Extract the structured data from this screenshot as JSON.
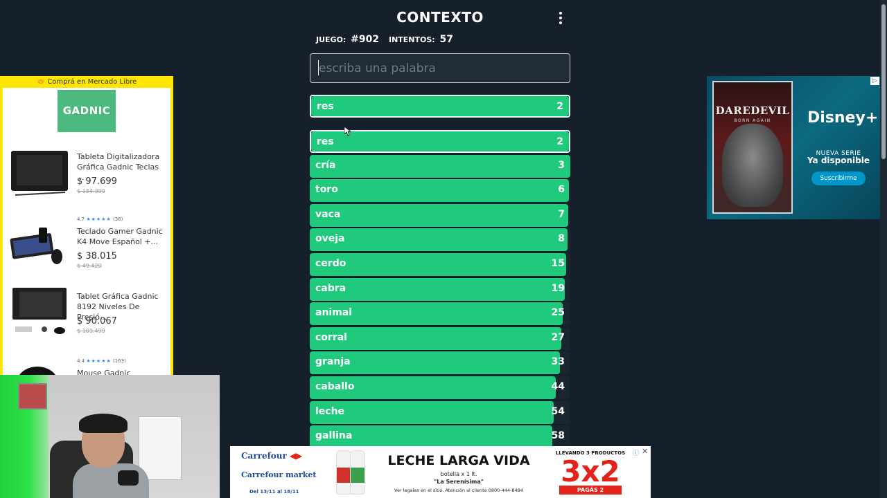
{
  "header": {
    "title": "CONTEXTO"
  },
  "stats": {
    "game_label": "JUEGO:",
    "game_value": "#902",
    "attempts_label": "INTENTOS:",
    "attempts_value": "57"
  },
  "input": {
    "placeholder": "escriba una palabra",
    "value": ""
  },
  "last_guess": {
    "word": "res",
    "rank": "2"
  },
  "guesses": [
    {
      "word": "res",
      "rank": "2",
      "fill": 1.0
    },
    {
      "word": "cría",
      "rank": "3",
      "fill": 1.0
    },
    {
      "word": "toro",
      "rank": "6",
      "fill": 0.995
    },
    {
      "word": "vaca",
      "rank": "7",
      "fill": 0.993
    },
    {
      "word": "oveja",
      "rank": "8",
      "fill": 0.99
    },
    {
      "word": "cerdo",
      "rank": "15",
      "fill": 0.985
    },
    {
      "word": "cabra",
      "rank": "19",
      "fill": 0.98
    },
    {
      "word": "animal",
      "rank": "25",
      "fill": 0.97
    },
    {
      "word": "corral",
      "rank": "27",
      "fill": 0.965
    },
    {
      "word": "granja",
      "rank": "33",
      "fill": 0.96
    },
    {
      "word": "caballo",
      "rank": "44",
      "fill": 0.945
    },
    {
      "word": "leche",
      "rank": "54",
      "fill": 0.935
    },
    {
      "word": "gallina",
      "rank": "58",
      "fill": 0.93
    }
  ],
  "ml_ad": {
    "top_label": "Comprá en Mercado Libre",
    "brand": "GADNIC",
    "products": [
      {
        "name": "Tableta Digitalizadora Gráfica Gadnic Teclas ...",
        "price": "$ 97.699",
        "old_price": "$ 134.399",
        "rating": "",
        "reviews": ""
      },
      {
        "name": "Teclado Gamer Gadnic K4 Move Español +...",
        "price": "$ 38.015",
        "old_price": "$ 49.420",
        "rating": "4.7",
        "reviews": "(38)"
      },
      {
        "name": "Tablet Gráfica Gadnic 8192 Niveles De Presió...",
        "price": "$ 90.067",
        "old_price": "$ 101.499",
        "rating": "",
        "reviews": ""
      },
      {
        "name": "Mouse Gadnic",
        "price": "",
        "old_price": "",
        "rating": "4.4",
        "reviews": "(163)"
      }
    ]
  },
  "disney_ad": {
    "poster_title": "DAREDEVIL",
    "poster_sub": "BORN AGAIN",
    "logo": "Disney+",
    "series_label": "NUEVA SERIE",
    "available": "Ya disponible",
    "button": "Suscribirme"
  },
  "carrefour_ad": {
    "logo1": "Carrefour",
    "logo2": "Carrefour market",
    "dates": "Del 13/11 al 18/11",
    "title": "LECHE LARGA VIDA",
    "sub1": "botella x 1 lt.",
    "sub2": "\"La Serenísima\"",
    "legal": "Ver legales en el sitio. Atención al cliente 0800-444-8484",
    "promo_top": "LLEVANDO 3 PRODUCTOS",
    "promo_big": "3x2",
    "promo_bottom": "PAGÁS 2"
  },
  "colors": {
    "background": "#16202b",
    "bar_fill": "#1fca7c",
    "ml_yellow": "#ffe600"
  }
}
